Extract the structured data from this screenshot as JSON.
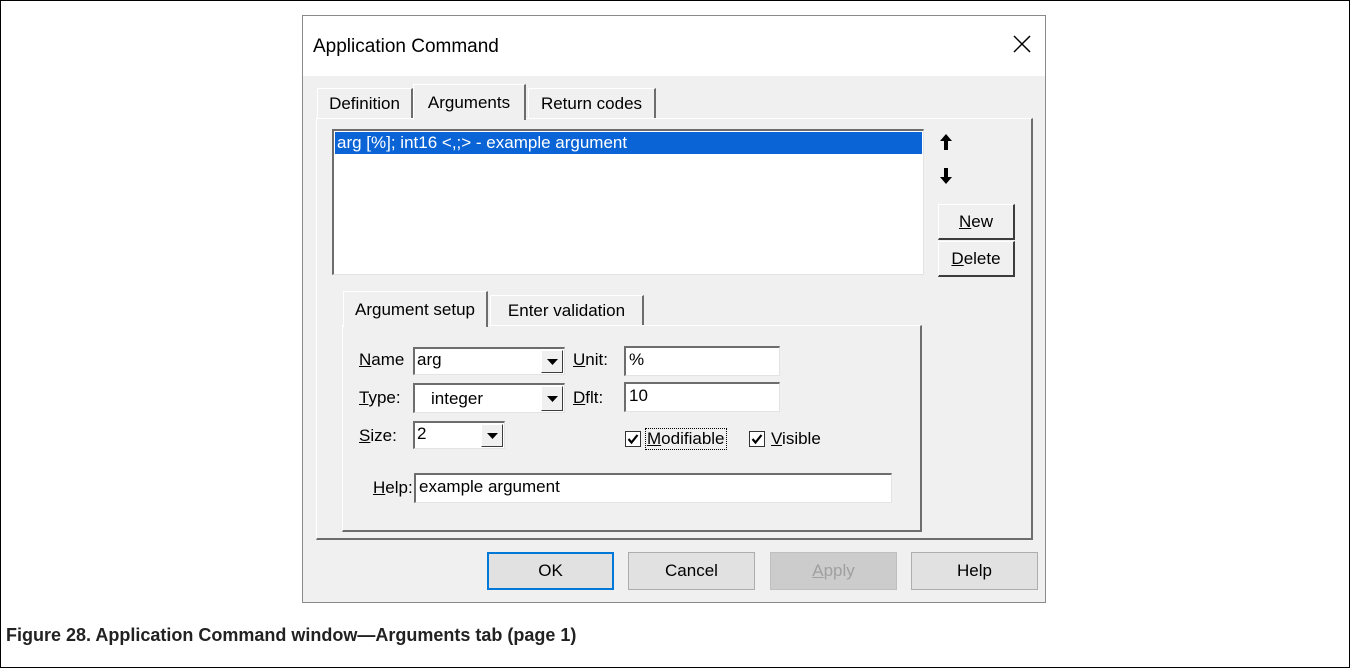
{
  "dialog": {
    "title": "Application Command",
    "tabs": [
      {
        "label": "Definition",
        "active": false
      },
      {
        "label": "Arguments",
        "active": true
      },
      {
        "label": "Return codes",
        "active": false
      }
    ],
    "arguments_list": {
      "items": [
        "arg [%]; int16 <,;> - example argument"
      ],
      "selected_index": 0
    },
    "side_buttons": {
      "move_up_icon": "arrow-up-icon",
      "move_down_icon": "arrow-down-icon",
      "new_label_mnemonic": "N",
      "new_label_rest": "ew",
      "delete_label_mnemonic": "D",
      "delete_label_rest": "elete"
    },
    "sub_tabs": [
      {
        "label": "Argument setup",
        "active": true
      },
      {
        "label": "Enter validation",
        "active": false
      }
    ],
    "form": {
      "name_label_m": "N",
      "name_label_rest": "ame",
      "name_value": "arg",
      "unit_label_m": "U",
      "unit_label_rest": "nit:",
      "unit_value": "%",
      "type_label_m": "T",
      "type_label_rest": "ype:",
      "type_value": "integer",
      "dflt_label_m": "D",
      "dflt_label_rest": "flt:",
      "dflt_value": "10",
      "size_label_m": "S",
      "size_label_rest": "ize:",
      "size_value": "2",
      "modifiable_label_m": "M",
      "modifiable_label_rest": "odifiable",
      "modifiable_checked": true,
      "visible_label_m": "V",
      "visible_label_rest": "isible",
      "visible_checked": true,
      "help_label_m": "H",
      "help_label_rest": "elp:",
      "help_value": "example argument"
    },
    "buttons": {
      "ok": "OK",
      "cancel": "Cancel",
      "apply_m": "A",
      "apply_rest": "pply",
      "help": "Help"
    }
  },
  "caption": "Figure 28. Application Command window—Arguments tab (page 1)"
}
